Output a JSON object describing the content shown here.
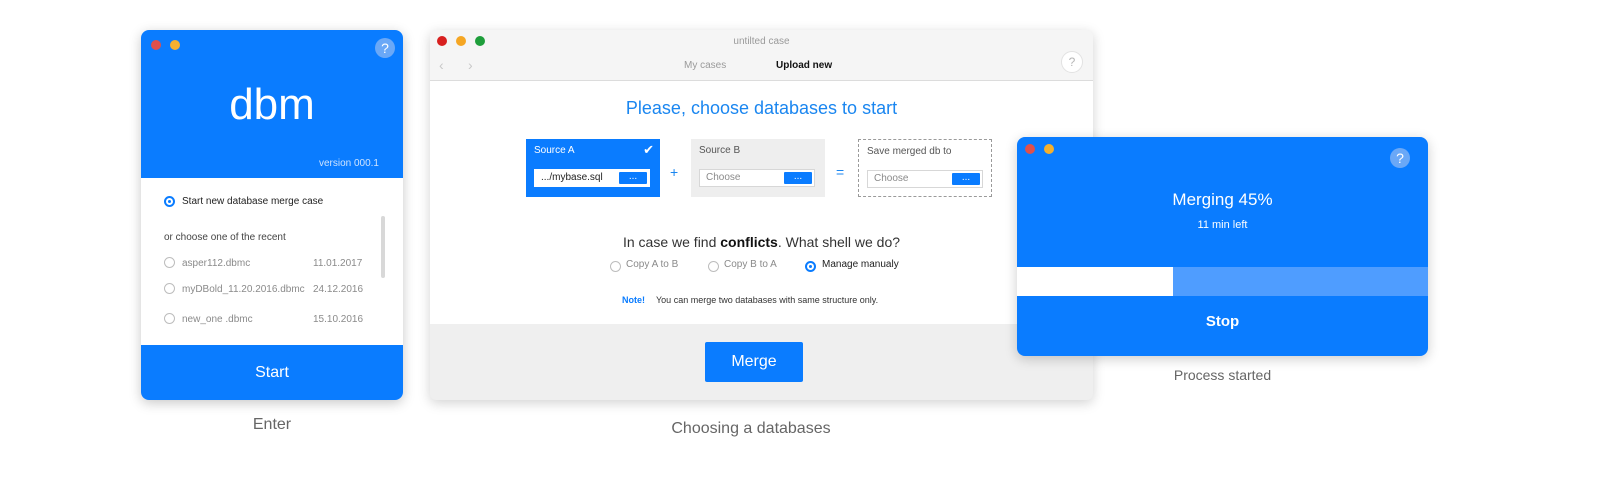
{
  "colors": {
    "accent": "#0a7cff",
    "accent_light": "#4f9dff",
    "window_red": "#e0504c",
    "window_yellow": "#f5b02e",
    "window_green": "#2fa94c"
  },
  "enter": {
    "logo": "dbm",
    "version": "version 000.1",
    "help_icon": "question-mark",
    "new_case_label": "Start new database merge case",
    "recent_label": "or choose one of the recent",
    "recent_items": [
      {
        "name": "asper112.dbmc",
        "date": "11.01.2017"
      },
      {
        "name": "myDBold_11.20.2016.dbmc",
        "date": "24.12.2016"
      },
      {
        "name": "new_one .dbmc",
        "date": "15.10.2016"
      }
    ],
    "start_label": "Start",
    "caption": "Enter"
  },
  "choose": {
    "window_title": "untilted case",
    "tabs": [
      "My cases",
      "Upload new"
    ],
    "active_tab": "Upload new",
    "heading": "Please, choose databases to start",
    "source_a": {
      "label": "Source A",
      "value": ".../mybase.sql",
      "button": "..."
    },
    "plus": "+",
    "source_b": {
      "label": "Source B",
      "placeholder": "Choose",
      "button": "..."
    },
    "equals": "=",
    "target": {
      "label": "Save merged db to",
      "placeholder": "Choose",
      "button": "..."
    },
    "conflicts_prefix": "In case we find ",
    "conflicts_bold": "conflicts",
    "conflicts_suffix": ". What shell we do?",
    "options": [
      "Copy A to B",
      "Copy B to A",
      "Manage manualy"
    ],
    "selected_option": "Manage manualy",
    "note_label": "Note!",
    "note_text": "You can merge two databases with same structure only.",
    "merge_label": "Merge",
    "caption": "Choosing a databases",
    "help_icon": "question-mark"
  },
  "process": {
    "title": "Merging 45%",
    "progress": 0.38,
    "time_left": "11 min left",
    "stop_label": "Stop",
    "caption": "Process started",
    "help_icon": "question-mark"
  }
}
